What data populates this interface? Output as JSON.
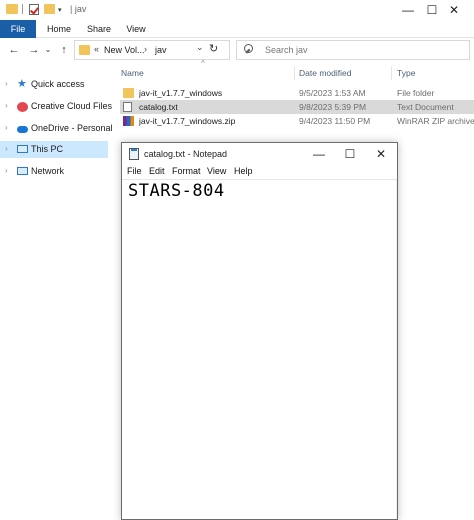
{
  "explorer": {
    "title_path": "| jav",
    "window_controls": {
      "minimize": "—",
      "maximize": "☐",
      "close": "✕"
    },
    "ribbon_tabs": [
      "File",
      "Home",
      "Share",
      "View"
    ],
    "nav_buttons": {
      "back": "←",
      "forward": "→",
      "recent": "⌄",
      "up": "↑"
    },
    "address": {
      "prefix": "«",
      "segment1": "New Vol...",
      "separator": "›",
      "segment2": "jav",
      "dropdown": "⌄",
      "refresh": "↻"
    },
    "search": {
      "placeholder": "Search jav"
    },
    "sidebar": {
      "items": [
        {
          "label": "Quick access",
          "icon": "star-icon"
        },
        {
          "label": "Creative Cloud Files",
          "icon": "creative-cloud-icon"
        },
        {
          "label": "OneDrive - Personal",
          "icon": "cloud-icon"
        },
        {
          "label": "This PC",
          "icon": "computer-icon",
          "selected": true
        },
        {
          "label": "Network",
          "icon": "network-icon"
        }
      ],
      "expand_glyph": "›"
    },
    "columns": {
      "name": "Name",
      "date": "Date modified",
      "type": "Type",
      "sort_indicator": "^"
    },
    "files": [
      {
        "name": "jav-it_v1.7.7_windows",
        "date": "9/5/2023 1:53 AM",
        "type": "File folder",
        "icon": "folder-icon"
      },
      {
        "name": "catalog.txt",
        "date": "9/8/2023 5:39 PM",
        "type": "Text Document",
        "icon": "text-file-icon",
        "selected": true
      },
      {
        "name": "jav-it_v1.7.7_windows.zip",
        "date": "9/4/2023 11:50 PM",
        "type": "WinRAR ZIP archive",
        "icon": "zip-archive-icon"
      }
    ]
  },
  "notepad": {
    "title": "catalog.txt - Notepad",
    "window_controls": {
      "minimize": "—",
      "maximize": "☐",
      "close": "✕"
    },
    "menu": [
      "File",
      "Edit",
      "Format",
      "View",
      "Help"
    ],
    "content": "STARS-804"
  },
  "colors": {
    "accent": "#1a5ea8",
    "selection": "#cce8ff",
    "row_selected": "#d9d9d9",
    "folder": "#f2c55c"
  }
}
